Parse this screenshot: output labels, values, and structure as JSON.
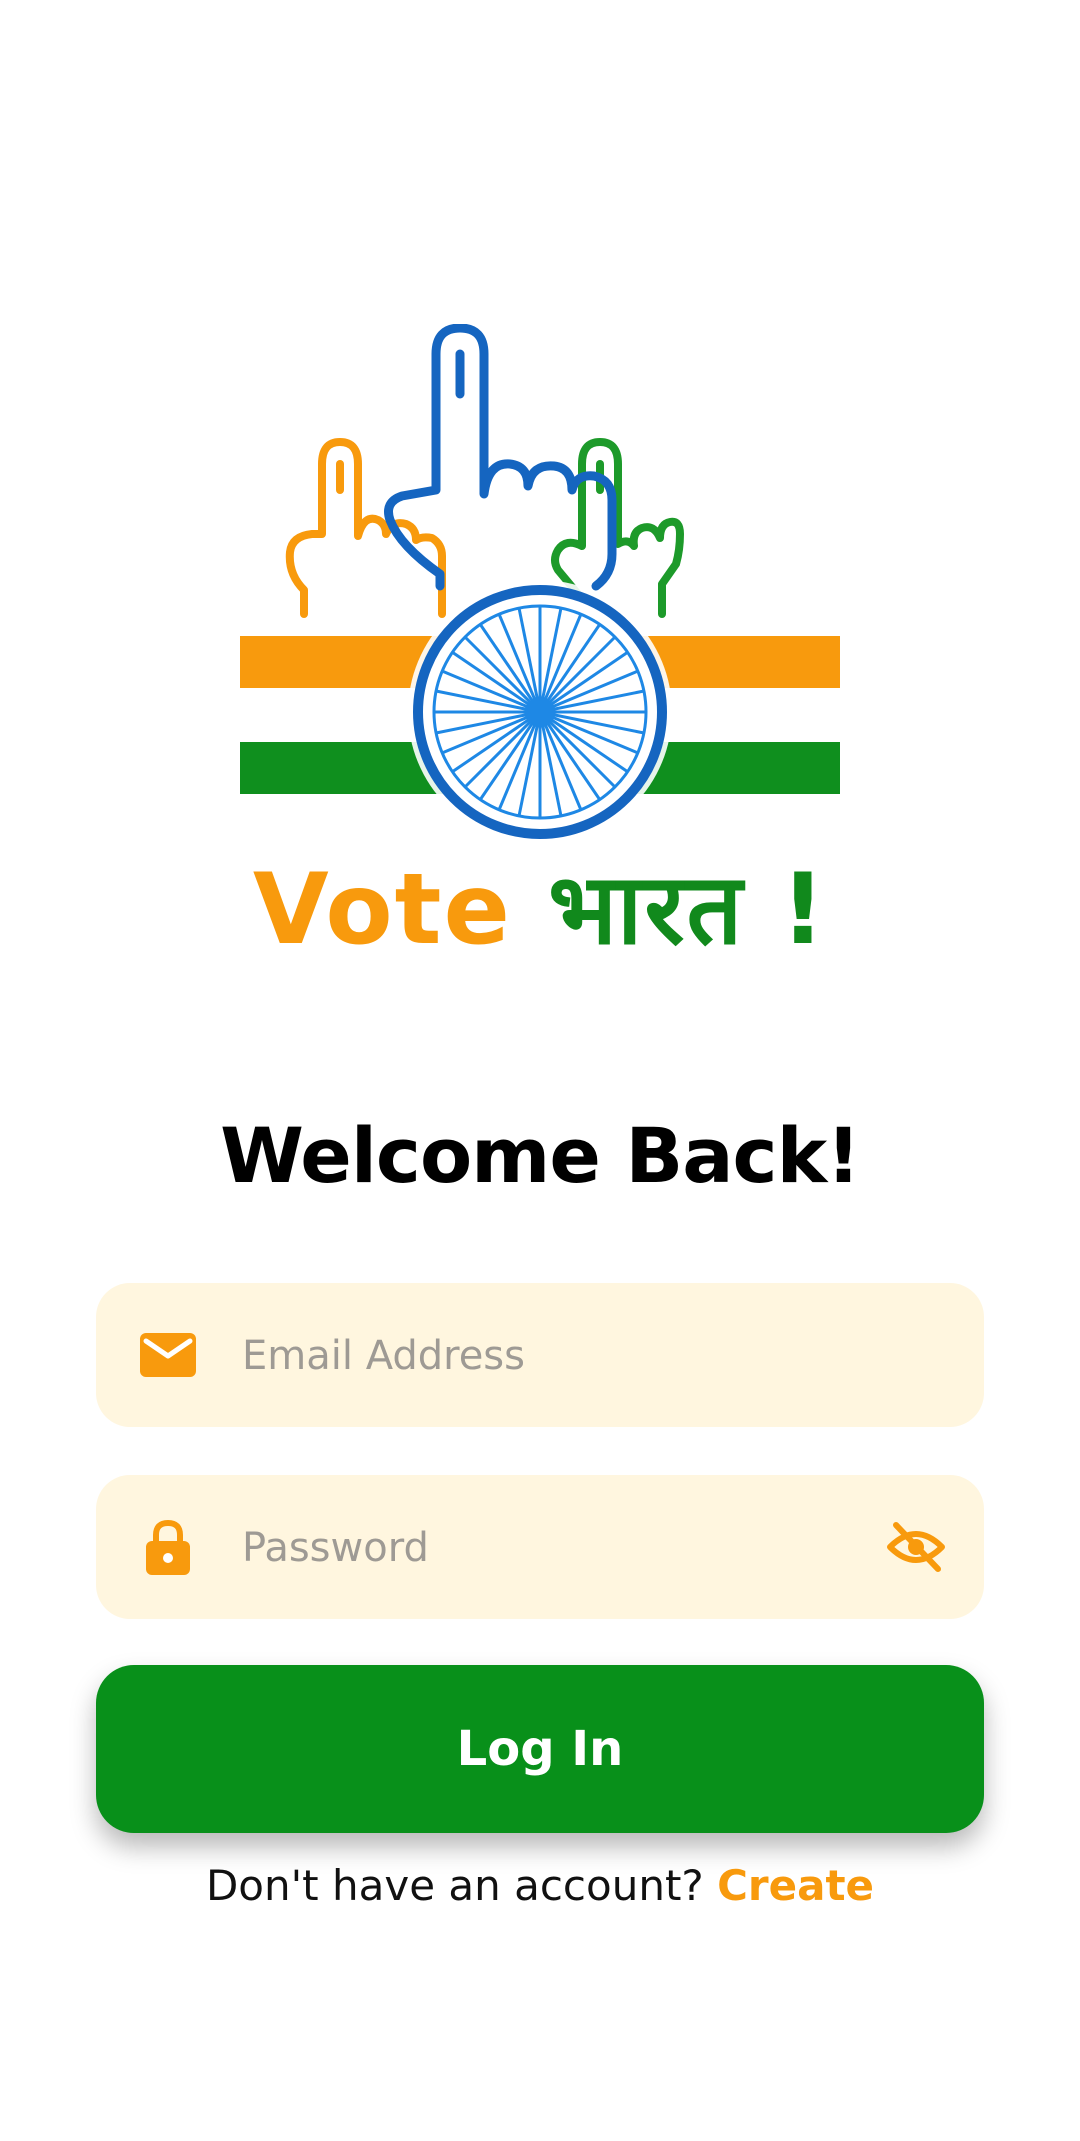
{
  "logo": {
    "word_vote": "Vote",
    "word_bharat": "भारत !"
  },
  "title": "Welcome Back!",
  "email": {
    "placeholder": "Email Address",
    "icon": "mail-icon"
  },
  "password": {
    "placeholder": "Password",
    "icon": "lock-icon",
    "toggle_icon": "eye-off-icon"
  },
  "login_button": "Log In",
  "signup": {
    "prompt": "Don't have an account?",
    "link": "Create"
  },
  "colors": {
    "saffron": "#F89A0D",
    "green": "#08901A",
    "blue": "#1565C0",
    "field_bg": "#FFF6DF"
  }
}
